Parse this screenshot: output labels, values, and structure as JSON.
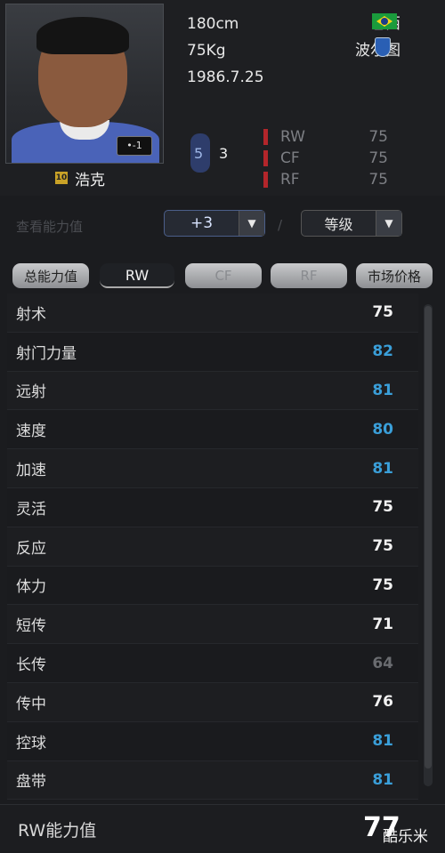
{
  "player": {
    "height": "180cm",
    "weight": "75Kg",
    "birth": "1986.7.25",
    "country": "巴西",
    "club": "波尔图",
    "number": "10",
    "name": "浩克",
    "photo_badge": "•-1"
  },
  "foot": {
    "left": "5",
    "right": "3"
  },
  "positions": [
    {
      "name": "RW",
      "value": "75"
    },
    {
      "name": "CF",
      "value": "75"
    },
    {
      "name": "RF",
      "value": "75"
    }
  ],
  "level": {
    "label": "查看能力值",
    "upgrade_value": "+3",
    "separator": "/",
    "grade_label": "等级"
  },
  "tabs": {
    "total": "总能力值",
    "rw": "RW",
    "cf": "CF",
    "rf": "RF",
    "market": "市场价格"
  },
  "attributes": [
    {
      "name": "射术",
      "value": "75",
      "color": "#f2f2f2"
    },
    {
      "name": "射门力量",
      "value": "82",
      "color": "#3a9fd9"
    },
    {
      "name": "远射",
      "value": "81",
      "color": "#3a9fd9"
    },
    {
      "name": "速度",
      "value": "80",
      "color": "#3a9fd9"
    },
    {
      "name": "加速",
      "value": "81",
      "color": "#3a9fd9"
    },
    {
      "name": "灵活",
      "value": "75",
      "color": "#f2f2f2"
    },
    {
      "name": "反应",
      "value": "75",
      "color": "#f2f2f2"
    },
    {
      "name": "体力",
      "value": "75",
      "color": "#f2f2f2"
    },
    {
      "name": "短传",
      "value": "71",
      "color": "#f2f2f2"
    },
    {
      "name": "长传",
      "value": "64",
      "color": "#6a6c70"
    },
    {
      "name": "传中",
      "value": "76",
      "color": "#f2f2f2"
    },
    {
      "name": "控球",
      "value": "81",
      "color": "#3a9fd9"
    },
    {
      "name": "盘带",
      "value": "81",
      "color": "#3a9fd9"
    }
  ],
  "summary": {
    "label": "RW能力值",
    "value": "77"
  },
  "watermark": "酷乐米"
}
